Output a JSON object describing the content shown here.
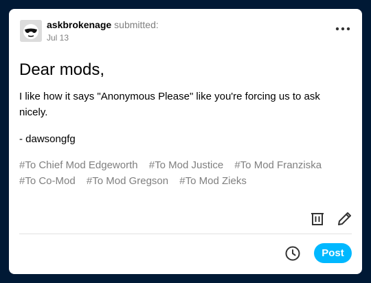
{
  "post": {
    "username": "askbrokenage",
    "submitted_label": "submitted:",
    "date": "Jul 13",
    "title": "Dear mods,",
    "body": [
      "I like how it says \"Anonymous Please\" like you're forcing us to ask nicely.",
      "- dawsongfg"
    ],
    "tags": [
      "#To Chief Mod Edgeworth",
      "#To Mod Justice",
      "#To Mod Franziska",
      "#To Co-Mod",
      "#To Mod Gregson",
      "#To Mod Zieks"
    ]
  },
  "actions": {
    "post_label": "Post"
  },
  "icons": {
    "more": "ellipsis-icon",
    "delete": "trash-icon",
    "edit": "pencil-icon",
    "schedule": "clock-icon"
  },
  "colors": {
    "background": "#001935",
    "accent": "#00b8ff",
    "muted_text": "#7f7f7f"
  }
}
